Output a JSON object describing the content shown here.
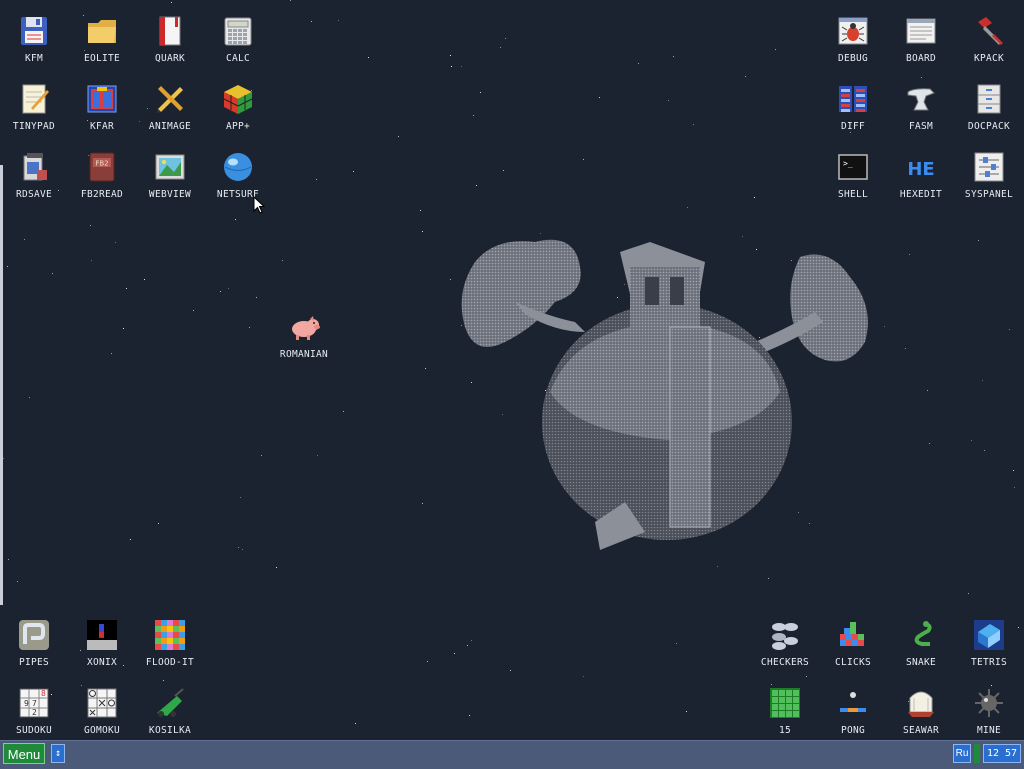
{
  "desktop": {
    "icons_top_left": [
      {
        "label": "KFM",
        "icon": "floppy-disk-icon"
      },
      {
        "label": "EOLITE",
        "icon": "folder-icon"
      },
      {
        "label": "QUARK",
        "icon": "book-icon"
      },
      {
        "label": "CALC",
        "icon": "calculator-icon"
      },
      {
        "label": "TINYPAD",
        "icon": "notepad-icon"
      },
      {
        "label": "KFAR",
        "icon": "archive-icon"
      },
      {
        "label": "ANIMAGE",
        "icon": "pencil-ruler-icon"
      },
      {
        "label": "APP+",
        "icon": "rubik-cube-icon"
      },
      {
        "label": "RDSAVE",
        "icon": "disk-save-icon"
      },
      {
        "label": "FB2READ",
        "icon": "fb2-book-icon"
      },
      {
        "label": "WEBVIEW",
        "icon": "web-image-icon"
      },
      {
        "label": "NETSURF",
        "icon": "globe-icon"
      }
    ],
    "icons_top_right": [
      {
        "label": "DEBUG",
        "icon": "bug-icon"
      },
      {
        "label": "BOARD",
        "icon": "board-icon"
      },
      {
        "label": "KPACK",
        "icon": "hammer-icon"
      },
      {
        "label": "DIFF",
        "icon": "diff-icon"
      },
      {
        "label": "FASM",
        "icon": "anvil-icon"
      },
      {
        "label": "DOCPACK",
        "icon": "cabinet-icon"
      },
      {
        "label": "SHELL",
        "icon": "terminal-icon"
      },
      {
        "label": "HEXEDIT",
        "icon": "hex-icon"
      },
      {
        "label": "SYSPANEL",
        "icon": "sliders-icon"
      }
    ],
    "icon_middle": {
      "label": "ROMANIAN",
      "icon": "pig-icon"
    },
    "icons_bottom_left": [
      {
        "label": "PIPES",
        "icon": "pipes-icon"
      },
      {
        "label": "XONIX",
        "icon": "xonix-icon"
      },
      {
        "label": "FLOOD-IT",
        "icon": "flood-it-icon"
      },
      {
        "label": "SUDOKU",
        "icon": "sudoku-icon"
      },
      {
        "label": "GOMOKU",
        "icon": "gomoku-icon"
      },
      {
        "label": "KOSILKA",
        "icon": "lawnmower-icon"
      }
    ],
    "icons_bottom_right": [
      {
        "label": "CHECKERS",
        "icon": "checkers-icon"
      },
      {
        "label": "CLICKS",
        "icon": "clicks-icon"
      },
      {
        "label": "SNAKE",
        "icon": "snake-icon"
      },
      {
        "label": "TETRIS",
        "icon": "tetris-icon"
      },
      {
        "label": "15",
        "icon": "fifteen-icon"
      },
      {
        "label": "PONG",
        "icon": "pong-icon"
      },
      {
        "label": "SEAWAR",
        "icon": "seawar-icon"
      },
      {
        "label": "MINE",
        "icon": "mine-icon"
      }
    ]
  },
  "taskbar": {
    "menu_label": "Menu",
    "scroll_symbol": "↕",
    "lang": "Ru",
    "clock": "12 57"
  },
  "colors": {
    "background": "#1b2230",
    "taskbar": "#4a5a78",
    "menu_green": "#1f8a3a",
    "tray_blue": "#2a6fcf"
  }
}
